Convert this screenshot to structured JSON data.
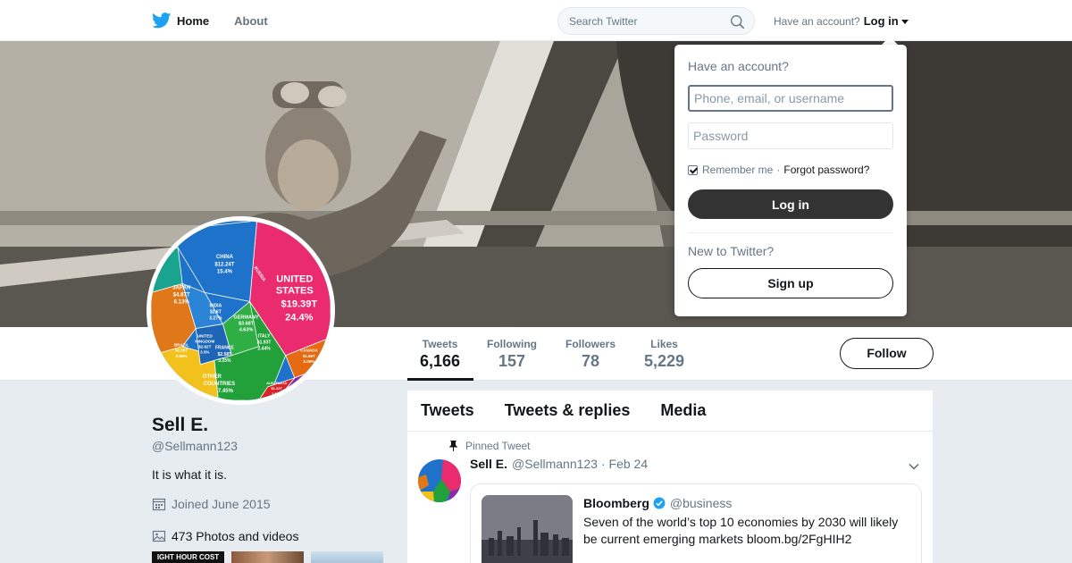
{
  "nav": {
    "home": "Home",
    "about": "About",
    "search_placeholder": "Search Twitter",
    "account_prompt": "Have an account?",
    "login_label": "Log in"
  },
  "login_dropdown": {
    "title": "Have an account?",
    "username_placeholder": "Phone, email, or username",
    "password_placeholder": "Password",
    "remember_me": "Remember me",
    "separator": "·",
    "forgot_password": "Forgot password?",
    "login_button": "Log in",
    "new_prompt": "New to Twitter?",
    "signup_button": "Sign up"
  },
  "profile": {
    "name": "Sell E.",
    "handle": "@Sellmann123",
    "bio": "It is what it is.",
    "joined": "Joined June 2015",
    "photos": "473 Photos and videos",
    "thumb1_text": "IGHT HOUR COST"
  },
  "stats": [
    {
      "label": "Tweets",
      "value": "6,166"
    },
    {
      "label": "Following",
      "value": "157"
    },
    {
      "label": "Followers",
      "value": "78"
    },
    {
      "label": "Likes",
      "value": "5,229"
    }
  ],
  "follow_button": "Follow",
  "avatar_chart": {
    "labels": [
      {
        "text": "CHINA",
        "sub": "$12.24T",
        "pct": "15.4%"
      },
      {
        "text": "UNITED",
        "text2": "STATES",
        "sub": "$19.39T",
        "pct": "24.4%"
      },
      {
        "text": "JAPAN",
        "sub": "$4.87T",
        "pct": "6.13%"
      },
      {
        "text": "GERMANY",
        "sub": "$3.68T",
        "pct": "4.63%"
      },
      {
        "text": "OTHER",
        "text2": "COUNTRIES",
        "pct": "7.45%"
      },
      {
        "text": "INDIA",
        "sub": "$2.6T",
        "pct": "3.27%"
      },
      {
        "text": "FRANCE",
        "sub": "$2.58T",
        "pct": "3.25%"
      },
      {
        "text": "ITALY",
        "sub": "$1.93T",
        "pct": "2.44%"
      },
      {
        "text": "UNITED",
        "text2": "KINGDOM",
        "sub": "$2.62T",
        "pct": "3.3%"
      },
      {
        "text": "BRAZIL",
        "sub": "$2.05T",
        "pct": "2.59%"
      },
      {
        "text": "CANADA",
        "sub": "$1.65T",
        "pct": "2.08%"
      },
      {
        "text": "RUSSIA"
      },
      {
        "text": "AUSTRALIA",
        "sub": "$1.32T",
        "pct": "1.67%"
      }
    ]
  },
  "timeline": {
    "tabs": [
      "Tweets",
      "Tweets & replies",
      "Media"
    ],
    "pinned_label": "Pinned Tweet",
    "tweet": {
      "name": "Sell E.",
      "handle": "@Sellmann123",
      "date": "· Feb 24"
    },
    "quote": {
      "name": "Bloomberg",
      "handle": "@business",
      "text": "Seven of the world’s top 10 economies by 2030 will likely be current emerging markets bloom.bg/2FgHIH2"
    }
  },
  "colors": {
    "twitter_blue": "#1da1f2",
    "dark_button": "#333333",
    "text_secondary": "#657786"
  }
}
